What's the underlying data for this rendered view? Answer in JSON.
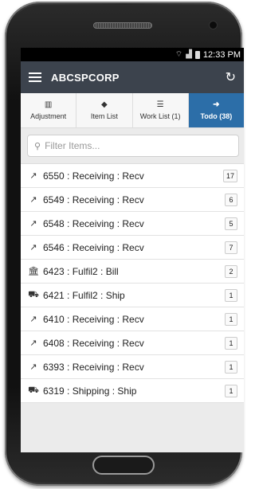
{
  "statusbar": {
    "time": "12:33 PM",
    "wifi_icon": "wifi-icon",
    "signal_icon": "signal-icon",
    "battery_icon": "battery-icon"
  },
  "appbar": {
    "title": "ABCSPCORP",
    "menu_icon": "hamburger-menu-icon",
    "refresh_icon": "refresh-icon"
  },
  "tabs": [
    {
      "label": "Adjustment",
      "icon": "barcode-icon",
      "active": false
    },
    {
      "label": "Item List",
      "icon": "tag-icon",
      "active": false
    },
    {
      "label": "Work List (1)",
      "icon": "list-icon",
      "active": false
    },
    {
      "label": "Todo (38)",
      "icon": "arrow-right-icon",
      "active": true
    }
  ],
  "search": {
    "placeholder": "Filter Items...",
    "value": ""
  },
  "items": [
    {
      "icon": "trend-icon",
      "label": "6550 : Receiving : Recv",
      "count": "17"
    },
    {
      "icon": "trend-icon",
      "label": "6549 : Receiving : Recv",
      "count": "6"
    },
    {
      "icon": "trend-icon",
      "label": "6548 : Receiving : Recv",
      "count": "5"
    },
    {
      "icon": "trend-icon",
      "label": "6546 : Receiving : Recv",
      "count": "7"
    },
    {
      "icon": "bank-icon",
      "label": "6423 : Fulfil2 : Bill",
      "count": "2"
    },
    {
      "icon": "truck-icon",
      "label": "6421 : Fulfil2 : Ship",
      "count": "1"
    },
    {
      "icon": "trend-icon",
      "label": "6410 : Receiving : Recv",
      "count": "1"
    },
    {
      "icon": "trend-icon",
      "label": "6408 : Receiving : Recv",
      "count": "1"
    },
    {
      "icon": "trend-icon",
      "label": "6393 : Receiving : Recv",
      "count": "1"
    },
    {
      "icon": "truck-icon",
      "label": "6319 : Shipping : Ship",
      "count": "1"
    }
  ],
  "colors": {
    "appbar": "#3c434d",
    "active_tab": "#2c6ea8"
  }
}
